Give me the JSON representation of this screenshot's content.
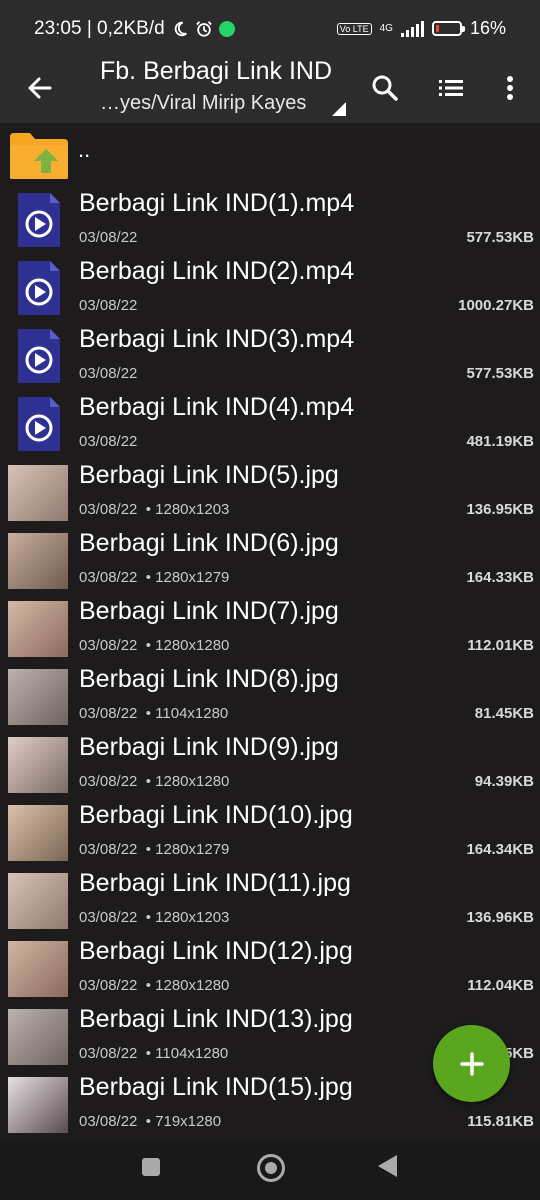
{
  "status_bar": {
    "time_net": "23:05 | 0,2KB/d",
    "network": "4G",
    "volte": "Vo LTE",
    "battery": "16%",
    "battery_level": 0.16
  },
  "toolbar": {
    "title": "Fb. Berbagi Link IND",
    "path": "…yes/Viral Mirip Kayes"
  },
  "parent": {
    "label": ".."
  },
  "files": [
    {
      "name": "Berbagi Link IND(1).mp4",
      "date": "03/08/22",
      "dims": "",
      "size": "577.53KB",
      "type": "video"
    },
    {
      "name": "Berbagi Link IND(2).mp4",
      "date": "03/08/22",
      "dims": "",
      "size": "1000.27KB",
      "type": "video"
    },
    {
      "name": "Berbagi Link IND(3).mp4",
      "date": "03/08/22",
      "dims": "",
      "size": "577.53KB",
      "type": "video"
    },
    {
      "name": "Berbagi Link IND(4).mp4",
      "date": "03/08/22",
      "dims": "",
      "size": "481.19KB",
      "type": "video"
    },
    {
      "name": "Berbagi Link IND(5).jpg",
      "date": "03/08/22",
      "dims": "• 1280x1203",
      "size": "136.95KB",
      "type": "image"
    },
    {
      "name": "Berbagi Link IND(6).jpg",
      "date": "03/08/22",
      "dims": "• 1280x1279",
      "size": "164.33KB",
      "type": "image"
    },
    {
      "name": "Berbagi Link IND(7).jpg",
      "date": "03/08/22",
      "dims": "• 1280x1280",
      "size": "112.01KB",
      "type": "image"
    },
    {
      "name": "Berbagi Link IND(8).jpg",
      "date": "03/08/22",
      "dims": "• 1104x1280",
      "size": "81.45KB",
      "type": "image"
    },
    {
      "name": "Berbagi Link IND(9).jpg",
      "date": "03/08/22",
      "dims": "• 1280x1280",
      "size": "94.39KB",
      "type": "image"
    },
    {
      "name": "Berbagi Link IND(10).jpg",
      "date": "03/08/22",
      "dims": "• 1280x1279",
      "size": "164.34KB",
      "type": "image"
    },
    {
      "name": "Berbagi Link IND(11).jpg",
      "date": "03/08/22",
      "dims": "• 1280x1203",
      "size": "136.96KB",
      "type": "image"
    },
    {
      "name": "Berbagi Link IND(12).jpg",
      "date": "03/08/22",
      "dims": "• 1280x1280",
      "size": "112.04KB",
      "type": "image"
    },
    {
      "name": "Berbagi Link IND(13).jpg",
      "date": "03/08/22",
      "dims": "• 1104x1280",
      "size": "5KB",
      "type": "image"
    },
    {
      "name": "Berbagi Link IND(15).jpg",
      "date": "03/08/22",
      "dims": "• 719x1280",
      "size": "115.81KB",
      "type": "image"
    }
  ],
  "colors": {
    "background": "#1d1b1c",
    "toolbar": "#2c2c2c",
    "video_icon": "#2e3192",
    "folder": "#f6a623",
    "folder_arrow": "#7cb342",
    "fab": "#5aa61e"
  },
  "icons": {
    "back": "arrow-left-icon",
    "search": "search-icon",
    "view": "list-view-icon",
    "more": "more-vert-icon",
    "fab": "plus-icon"
  }
}
